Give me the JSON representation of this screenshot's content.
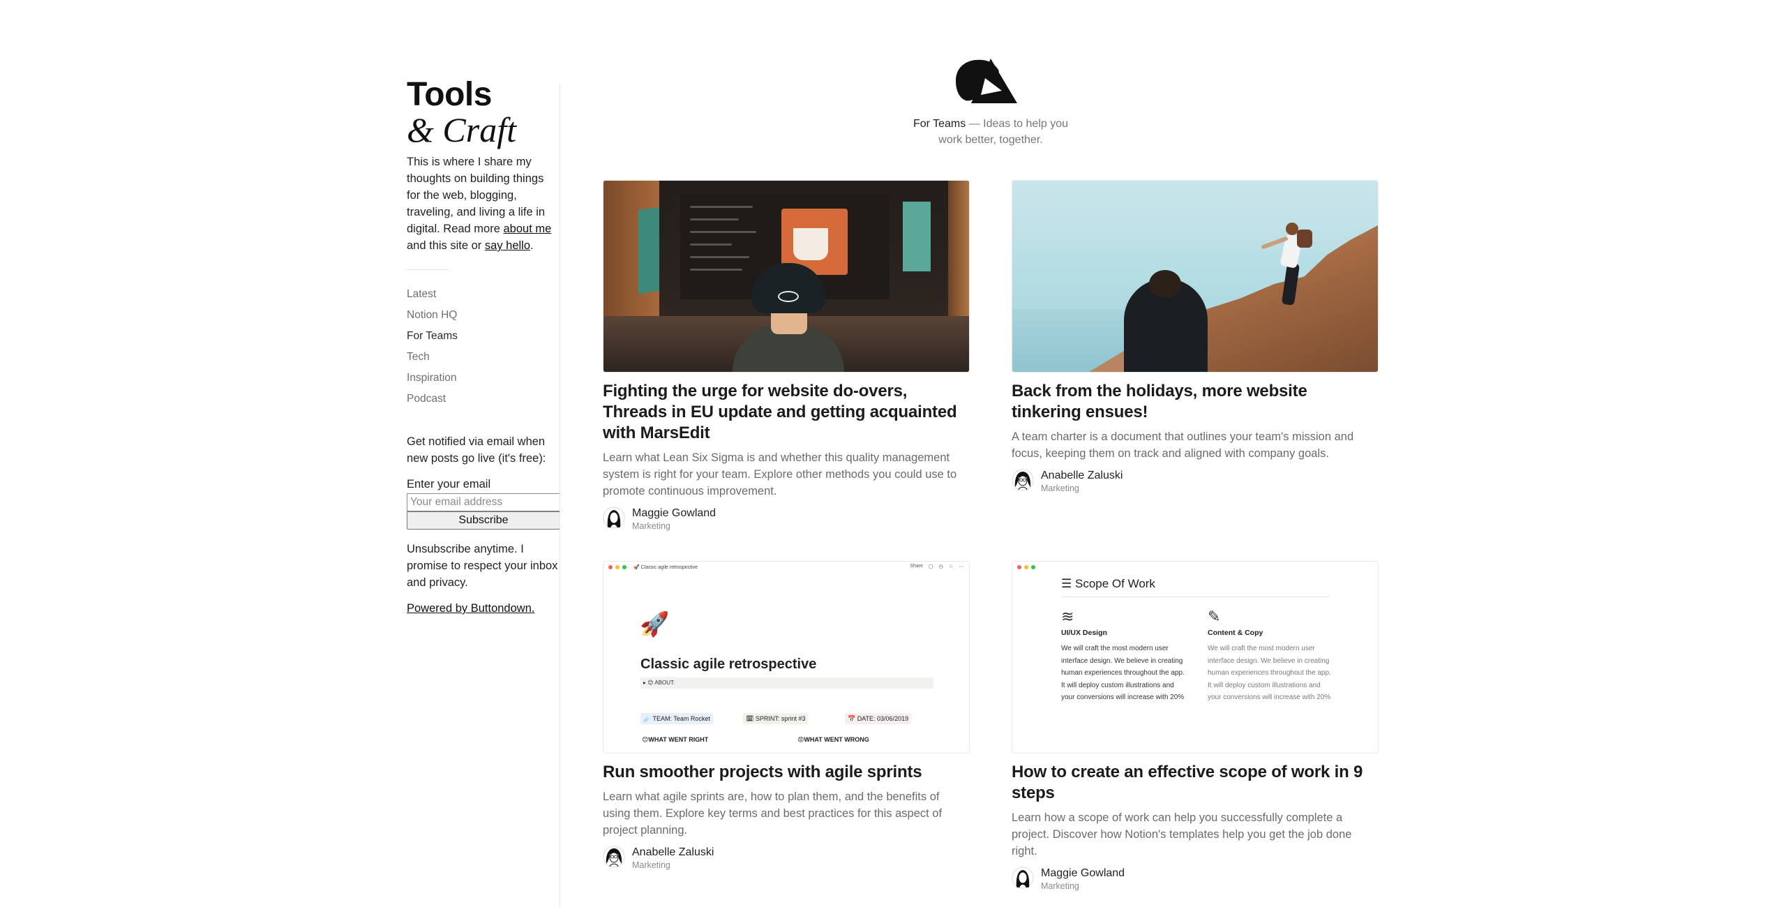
{
  "brand": {
    "title": "Tools",
    "subtitle": "& Craft",
    "intro_text": "This is where I share my thoughts on building things for the web, blogging, traveling, and living a life in digital. Read more ",
    "about_link": "about me",
    "intro_mid": " and this site or ",
    "hello_link": "say hello",
    "intro_end": "."
  },
  "nav": {
    "items": [
      {
        "label": "Latest"
      },
      {
        "label": "Notion HQ"
      },
      {
        "label": "For Teams"
      },
      {
        "label": "Tech"
      },
      {
        "label": "Inspiration"
      },
      {
        "label": "Podcast"
      }
    ],
    "active": "For Teams"
  },
  "newsletter": {
    "notify_text": "Get notified via email when new posts go live (it's free):",
    "email_label": "Enter your email",
    "email_placeholder": "Your email address",
    "email_value": "",
    "subscribe_label": "Subscribe",
    "unsubscribe_text": "Unsubscribe anytime. I promise to respect your inbox and privacy.",
    "powered_by": "Powered by Buttondown."
  },
  "header": {
    "section_name": "For Teams",
    "tagline_rest": " — Ideas to help you work better, together."
  },
  "cards": [
    {
      "title": "Fighting the urge for website do-overs, Threads in EU update and getting acquainted with MarsEdit",
      "description": "Learn what Lean Six Sigma is and whether this quality management system is right for your team. Explore other methods you could use to promote continuous improvement.",
      "author": "Maggie Gowland",
      "role": "Marketing"
    },
    {
      "title": "Back from the holidays, more website tinkering ensues!",
      "description": "A team charter is a document that outlines your team's mission and focus, keeping them on track and aligned with company goals.",
      "author": "Anabelle Zaluski",
      "role": "Marketing"
    },
    {
      "title": "Run smoother projects with agile sprints",
      "description": "Learn what agile sprints are, how to plan them, and the benefits of using them. Explore key terms and best practices for this aspect of project planning.",
      "author": "Anabelle Zaluski",
      "role": "Marketing"
    },
    {
      "title": "How to create an effective scope of work in 9 steps",
      "description": "Learn how a scope of work can help you successfully complete a project. Discover how Notion's templates help you get the job done right.",
      "author": "Maggie Gowland",
      "role": "Marketing"
    }
  ],
  "retro_thumb": {
    "window_title": "🚀 Classic agile retrospective",
    "share": "Share",
    "title": "Classic agile retrospective",
    "about": "▸ 😊 ABOUT:",
    "team": "☄️ TEAM: Team Rocket",
    "sprint": "🗓 SPRINT: sprint #3",
    "date": "📅 DATE: 03/06/2019",
    "went_right": "😊WHAT WENT RIGHT",
    "went_wrong": "😡WHAT WENT WRONG"
  },
  "scope_thumb": {
    "title": "Scope Of Work",
    "col1_head": "UI/UX Design",
    "col1_body": "We will craft the most modern user interface design. We believe in creating human experiences throughout the app. It will deploy custom illustrations and your conversions will increase with 20%",
    "col2_head": "Content & Copy",
    "col2_body": "We will craft the most modern user interface design. We believe in creating human experiences throughout the app. It will deploy custom illustrations and your conversions will increase with 20%"
  },
  "icons": {
    "logo": "brand-logo-icon",
    "avatar": "avatar-icon"
  },
  "colors": {
    "text": "#1f1f1f",
    "muted": "#6b6b6b",
    "accent_red": "#ff5f57",
    "accent_yellow": "#febc2e",
    "accent_green": "#28c840"
  }
}
